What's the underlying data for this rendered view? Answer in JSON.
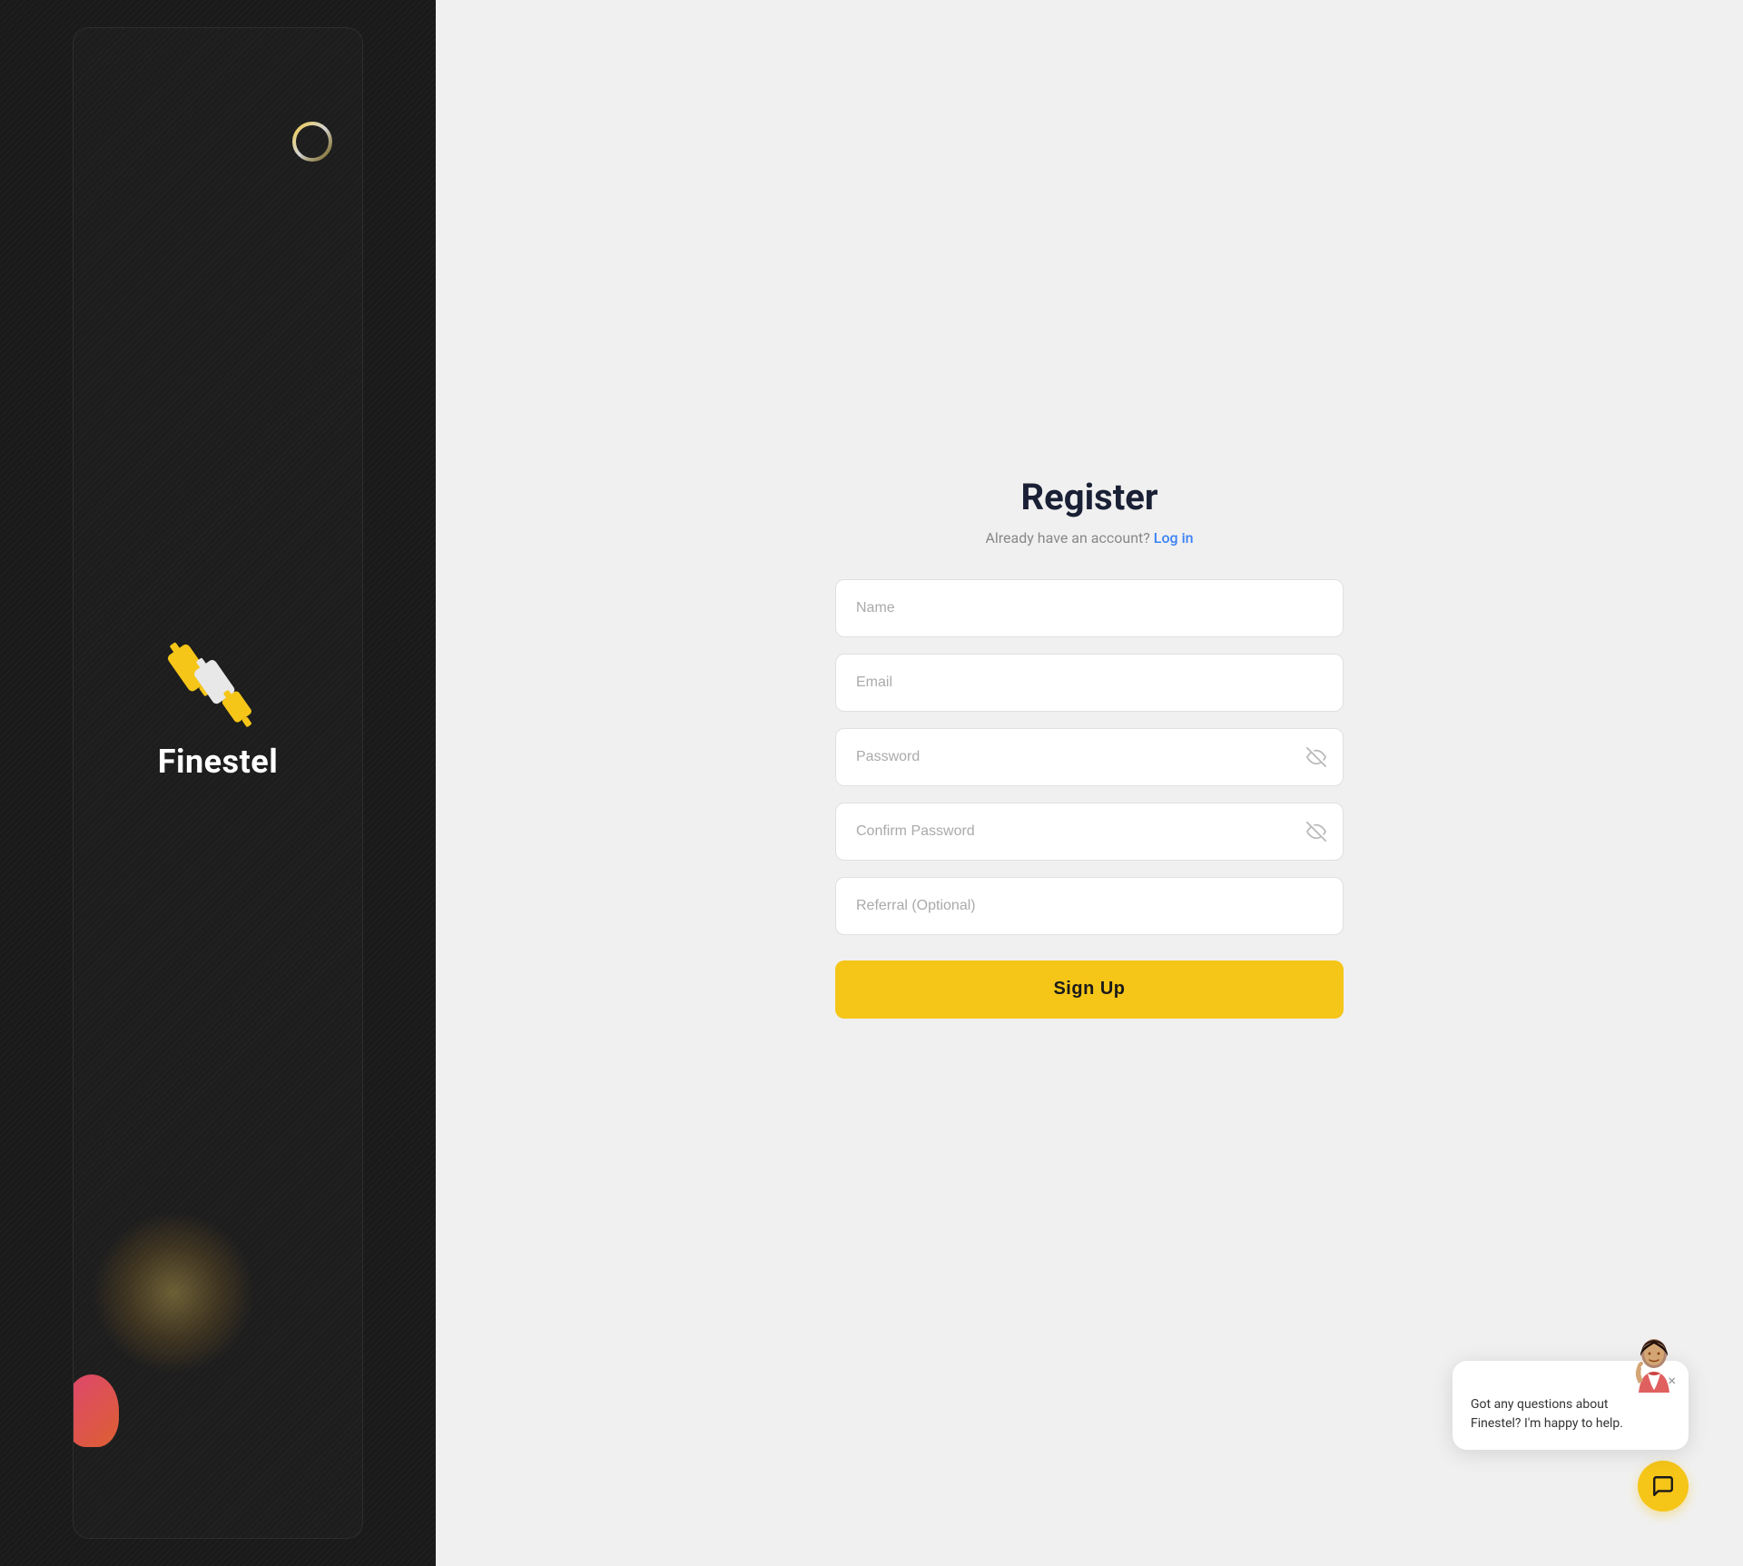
{
  "brand": {
    "name": "Finestel"
  },
  "register": {
    "title": "Register",
    "already_account": "Already have an account?",
    "login_label": "Log in",
    "fields": {
      "name_placeholder": "Name",
      "email_placeholder": "Email",
      "password_placeholder": "Password",
      "confirm_password_placeholder": "Confirm Password",
      "referral_placeholder": "Referral (Optional)"
    },
    "signup_label": "Sign Up"
  },
  "chat": {
    "message": "Got any questions about Finestel? I'm happy to help.",
    "close_label": "×"
  }
}
